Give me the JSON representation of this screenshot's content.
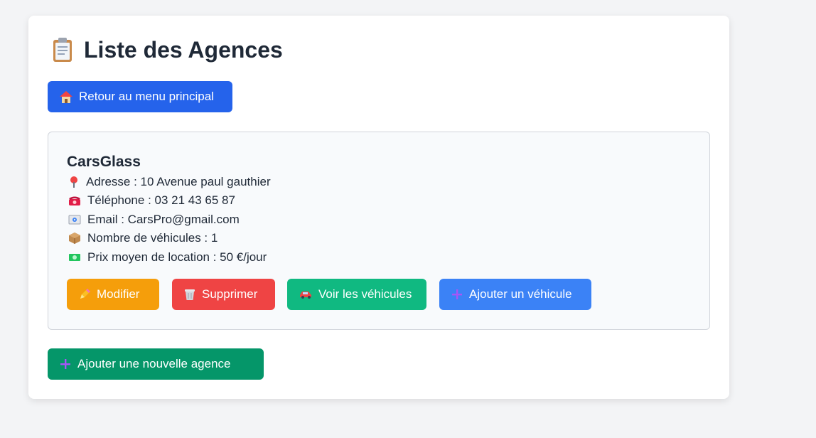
{
  "page": {
    "title": "Liste des Agences",
    "title_icon": "clipboard-icon"
  },
  "back_button": {
    "label": "Retour au menu principal",
    "icon": "house-icon"
  },
  "agency": {
    "name": "CarsGlass",
    "address": "Adresse : 10 Avenue paul gauthier",
    "phone": "Téléphone : 03 21 43 65 87",
    "email": "Email : CarsPro@gmail.com",
    "vehicle_count": "Nombre de véhicules : 1",
    "avg_price": "Prix moyen de location : 50 €/jour",
    "actions": {
      "edit": "Modifier",
      "delete": "Supprimer",
      "view": "Voir les véhicules",
      "add_vehicle": "Ajouter un véhicule"
    }
  },
  "add_agency_button": {
    "label": "Ajouter une nouvelle agence"
  },
  "colors": {
    "back": "#2563eb",
    "edit": "#f59e0b",
    "delete": "#ef4444",
    "view": "#10b981",
    "add_vehicle": "#3b82f6",
    "add_agency": "#059669"
  }
}
